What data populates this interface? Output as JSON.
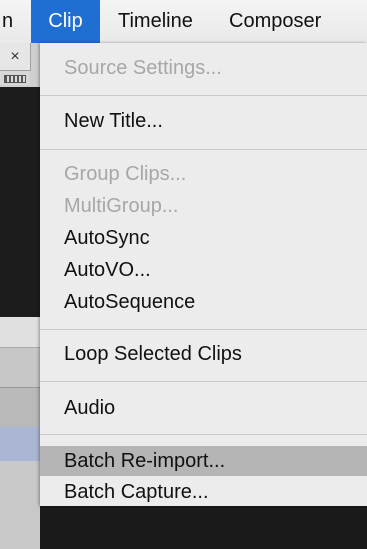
{
  "menubar": {
    "items": [
      {
        "label": "n"
      },
      {
        "label": "Clip"
      },
      {
        "label": "Timeline"
      },
      {
        "label": "Composer"
      }
    ]
  },
  "background_window": {
    "close_glyph": "×"
  },
  "clip_menu": {
    "items": [
      {
        "label": "Source Settings...",
        "enabled": false
      },
      {
        "label": "New Title...",
        "enabled": true
      },
      {
        "label": "Group Clips...",
        "enabled": false
      },
      {
        "label": "MultiGroup...",
        "enabled": false
      },
      {
        "label": "AutoSync",
        "enabled": true
      },
      {
        "label": "AutoVO...",
        "enabled": true
      },
      {
        "label": "AutoSequence",
        "enabled": true
      },
      {
        "label": "Loop Selected Clips",
        "enabled": true
      },
      {
        "label": "Audio",
        "enabled": true
      },
      {
        "label": "Batch Re-import...",
        "enabled": true,
        "highlighted": true
      },
      {
        "label": "Batch Capture...",
        "enabled": true
      }
    ]
  },
  "colors": {
    "menu_selected": "#1f6fd3",
    "menu_background": "#ececec",
    "disabled_text": "#a7a7a7",
    "highlight_row": "#b5b5b5"
  }
}
